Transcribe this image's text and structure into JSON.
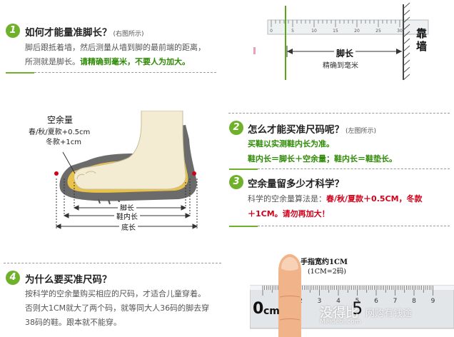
{
  "sections": {
    "s1": {
      "num": "1",
      "title": "如何才能量准脚长？",
      "note": "(右图所示)",
      "line1": "脚后跟抵着墙，然后测量从墙到脚的最前端的距离，",
      "line2_plain": "所测就是脚长。",
      "line2_green": "请精确到毫米，不要人为加大。"
    },
    "s2": {
      "num": "2",
      "title": "怎么才能买准尺码呢？",
      "note": "(左图所示)",
      "line1": "买鞋以实测鞋内长为准。",
      "line2": "鞋内长＝脚长＋空余量；鞋内长＝鞋垫长。"
    },
    "s3": {
      "num": "3",
      "title": "空余量留多少才科学？",
      "line1_plain": "科学的空余量算法是：",
      "line1_red": "春/秋/夏款＋0.5CM，冬款",
      "line2_red": "＋1CM。请勿再加大！"
    },
    "s4": {
      "num": "4",
      "title": "为什么要买准尺码？",
      "line1": "按科学的空余量购买相应的尺码，才适合儿童穿着。",
      "line2": "否则大1CM就大了两个码，就等同大人36码的脚去穿",
      "line3": "38码的鞋。跟本就不能穿。"
    }
  },
  "ruler_top": {
    "ticks": [
      "0",
      "5",
      "10",
      "15",
      "20",
      "25",
      "30"
    ],
    "wall": "靠墙",
    "foot_length": "脚长",
    "precision": "精确到毫米"
  },
  "shoe": {
    "allowance_title": "空余量",
    "allowance_spring": "春/秋/夏款+0.5cm",
    "allowance_winter": "冬款+1cm",
    "foot_length": "脚长",
    "inner_length": "鞋内长",
    "sole_length": "底长"
  },
  "finger": {
    "title": "手指宽约1CM",
    "subtitle": "(1CM=2码)",
    "ticks": [
      "0",
      "1",
      "2",
      "3",
      "4",
      "5",
      "6",
      "7",
      "8",
      "9"
    ],
    "big_zero": "0",
    "big_cm": "cm",
    "big_five": "5"
  },
  "watermark": {
    "text1": "没得比",
    "text2": "网购有钱途",
    "url": "Meidebi.com"
  },
  "colors": {
    "green": "#6fb12b",
    "red": "#d0021b",
    "text": "#333333"
  }
}
